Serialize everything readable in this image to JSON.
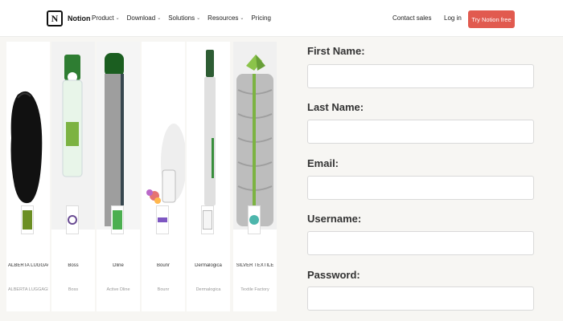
{
  "nav": {
    "logo_text": "Notion",
    "logo_glyph": "N",
    "menu": [
      {
        "label": "Product",
        "has_dropdown": true
      },
      {
        "label": "Download",
        "has_dropdown": true
      },
      {
        "label": "Solutions",
        "has_dropdown": true
      },
      {
        "label": "Resources",
        "has_dropdown": true
      },
      {
        "label": "Pricing",
        "has_dropdown": false
      }
    ],
    "contact_sales": "Contact sales",
    "login": "Log in",
    "cta": "Try Notion free",
    "cta_color": "#e15a4f"
  },
  "products": [
    {
      "name": "ALBERTA LUGGAGE",
      "subtitle": "ALBERTA LUGGAGE",
      "thumb": "logo"
    },
    {
      "name": "Boss",
      "subtitle": "Boss",
      "thumb": "logo"
    },
    {
      "name": "Dline",
      "subtitle": "Active Dline",
      "thumb": "logo"
    },
    {
      "name": "Bounr",
      "subtitle": "Bounr",
      "thumb": "logo"
    },
    {
      "name": "Dermalogica",
      "subtitle": "Dermalogica",
      "thumb": "logo"
    },
    {
      "name": "SILVER TEXTILE",
      "subtitle": "Textile Factory",
      "thumb": "logo"
    }
  ],
  "form": {
    "fields": [
      {
        "label": "First Name:",
        "value": "",
        "placeholder": ""
      },
      {
        "label": "Last Name:",
        "value": "",
        "placeholder": ""
      },
      {
        "label": "Email:",
        "value": "",
        "placeholder": ""
      },
      {
        "label": "Username:",
        "value": "",
        "placeholder": ""
      },
      {
        "label": "Password:",
        "value": "",
        "placeholder": ""
      }
    ]
  }
}
